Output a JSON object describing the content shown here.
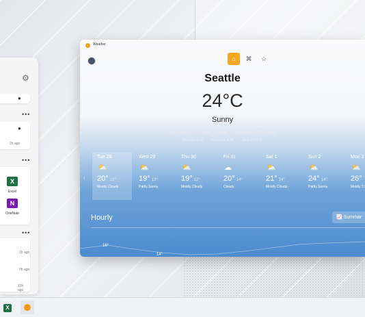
{
  "window": {
    "title": "Weather"
  },
  "nav": {
    "items": [
      {
        "icon": "home-icon",
        "label": "⌂"
      },
      {
        "icon": "radar-icon",
        "label": "⌘"
      },
      {
        "icon": "favorites-icon",
        "label": "☆"
      }
    ],
    "active": 0
  },
  "current": {
    "city": "Seattle",
    "temperature": "24°C",
    "condition": "Sunny",
    "feels_like": "Feels Like  18°",
    "wind": "Wind  → 10 mph",
    "barometer": "Barometer  1019.00 hPa",
    "visibility": "Visibility  6 mi",
    "humidity": "Humidity  41%",
    "dew_point": "Dew Point  6°"
  },
  "forecast": [
    {
      "name": "Tue 28",
      "hi": "20°",
      "lo": "13°",
      "desc": "Mostly Cloudy",
      "icon": "partly-cloudy-icon"
    },
    {
      "name": "Wed 29",
      "hi": "19°",
      "lo": "13°",
      "desc": "Partly Sunny",
      "icon": "partly-sunny-icon"
    },
    {
      "name": "Thu 30",
      "hi": "19°",
      "lo": "12°",
      "desc": "Mostly Cloudy",
      "icon": "partly-cloudy-icon"
    },
    {
      "name": "Fri 31",
      "hi": "20°",
      "lo": "14°",
      "desc": "Cloudy",
      "icon": "cloudy-icon"
    },
    {
      "name": "Sat 1",
      "hi": "21°",
      "lo": "14°",
      "desc": "Mostly Cloudy",
      "icon": "partly-cloudy-icon"
    },
    {
      "name": "Sun 2",
      "hi": "24°",
      "lo": "14°",
      "desc": "Partly Sunny",
      "icon": "partly-sunny-icon"
    },
    {
      "name": "Mon 3",
      "hi": "26°",
      "lo": "",
      "desc": "Mostly Cl",
      "icon": "partly-cloudy-icon"
    }
  ],
  "hourly": {
    "heading": "Hourly",
    "summary_label": "Summar",
    "labels": [
      "16°",
      "14°"
    ]
  },
  "sidebar": {
    "time_1": "2h ago",
    "time_2": "1h ago",
    "time_3": "5h ago",
    "time_4": "12h ago",
    "apps": [
      {
        "name": "Excel",
        "letter": "X",
        "color": "#1e7145"
      },
      {
        "name": "OneNote",
        "letter": "N",
        "color": "#7719aa"
      }
    ]
  },
  "taskbar": {
    "excel_letter": "X"
  },
  "colors": {
    "accent": "#f5a623",
    "excel": "#1e7145",
    "onenote": "#7719aa"
  }
}
